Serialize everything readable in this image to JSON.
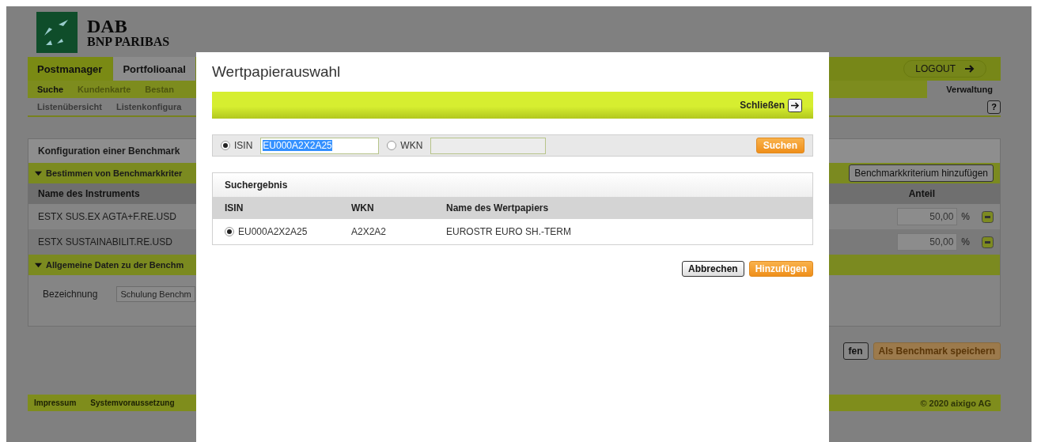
{
  "logo": {
    "name": "DAB",
    "subtitle": "BNP PARIBAS"
  },
  "main_nav": {
    "tabs": [
      {
        "label": "Postmanager",
        "selected": true
      },
      {
        "label": "Portfolioanal",
        "selected": false
      }
    ],
    "logout": "LOGOUT"
  },
  "sub_nav": {
    "items": [
      {
        "label": "Suche",
        "selected": true
      },
      {
        "label": "Kundenkarte",
        "selected": false
      },
      {
        "label": "Bestan",
        "selected": false
      }
    ],
    "right_item": "Verwaltung"
  },
  "third_nav": {
    "items": [
      "Listenübersicht",
      "Listenkonfigura"
    ],
    "help": "?"
  },
  "panel": {
    "title": "Konfiguration einer Benchmark",
    "criteria_section": {
      "title": "Bestimmen von Benchmarkkriter",
      "expanded": true,
      "add_button": "Benchmarkkriterium hinzufügen"
    },
    "columns": [
      "Name des Instruments",
      "Anteil"
    ],
    "rows": [
      {
        "name": "ESTX SUS.EX AGTA+F.RE.USD",
        "share": "50,00",
        "unit": "%"
      },
      {
        "name": "ESTX SUSTAINABILIT.RE.USD",
        "share": "50,00",
        "unit": "%"
      }
    ],
    "general_section": {
      "title": "Allgemeine Daten zu der Benchm",
      "expanded": true
    },
    "designation": {
      "label": "Bezeichnung",
      "value": "Schulung Benchm"
    }
  },
  "actions": [
    {
      "label": "fen",
      "kind": "secondary"
    },
    {
      "label": "Als Benchmark speichern",
      "kind": "primary"
    }
  ],
  "footer": {
    "links": [
      "Impressum",
      "Systemvoraussetzung"
    ],
    "copyright": "© 2020 aixigo AG"
  },
  "dialog": {
    "title": "Wertpapierauswahl",
    "close": "Schließen",
    "search": {
      "options": [
        {
          "label": "ISIN",
          "selected": true,
          "value": "EU000A2X2A25",
          "text_selected": true
        },
        {
          "label": "WKN",
          "selected": false
        }
      ],
      "button": "Suchen"
    },
    "results": {
      "title": "Suchergebnis",
      "columns": [
        "ISIN",
        "WKN",
        "Name des Wertpapiers"
      ],
      "rows": [
        {
          "selected": true,
          "isin": "EU000A2X2A25",
          "wkn": "A2X2A2",
          "name": "EUROSTR EURO SH.-TERM"
        }
      ]
    },
    "buttons": [
      {
        "label": "Abbrechen",
        "kind": "secondary"
      },
      {
        "label": "Hinzufügen",
        "kind": "primary"
      }
    ]
  }
}
